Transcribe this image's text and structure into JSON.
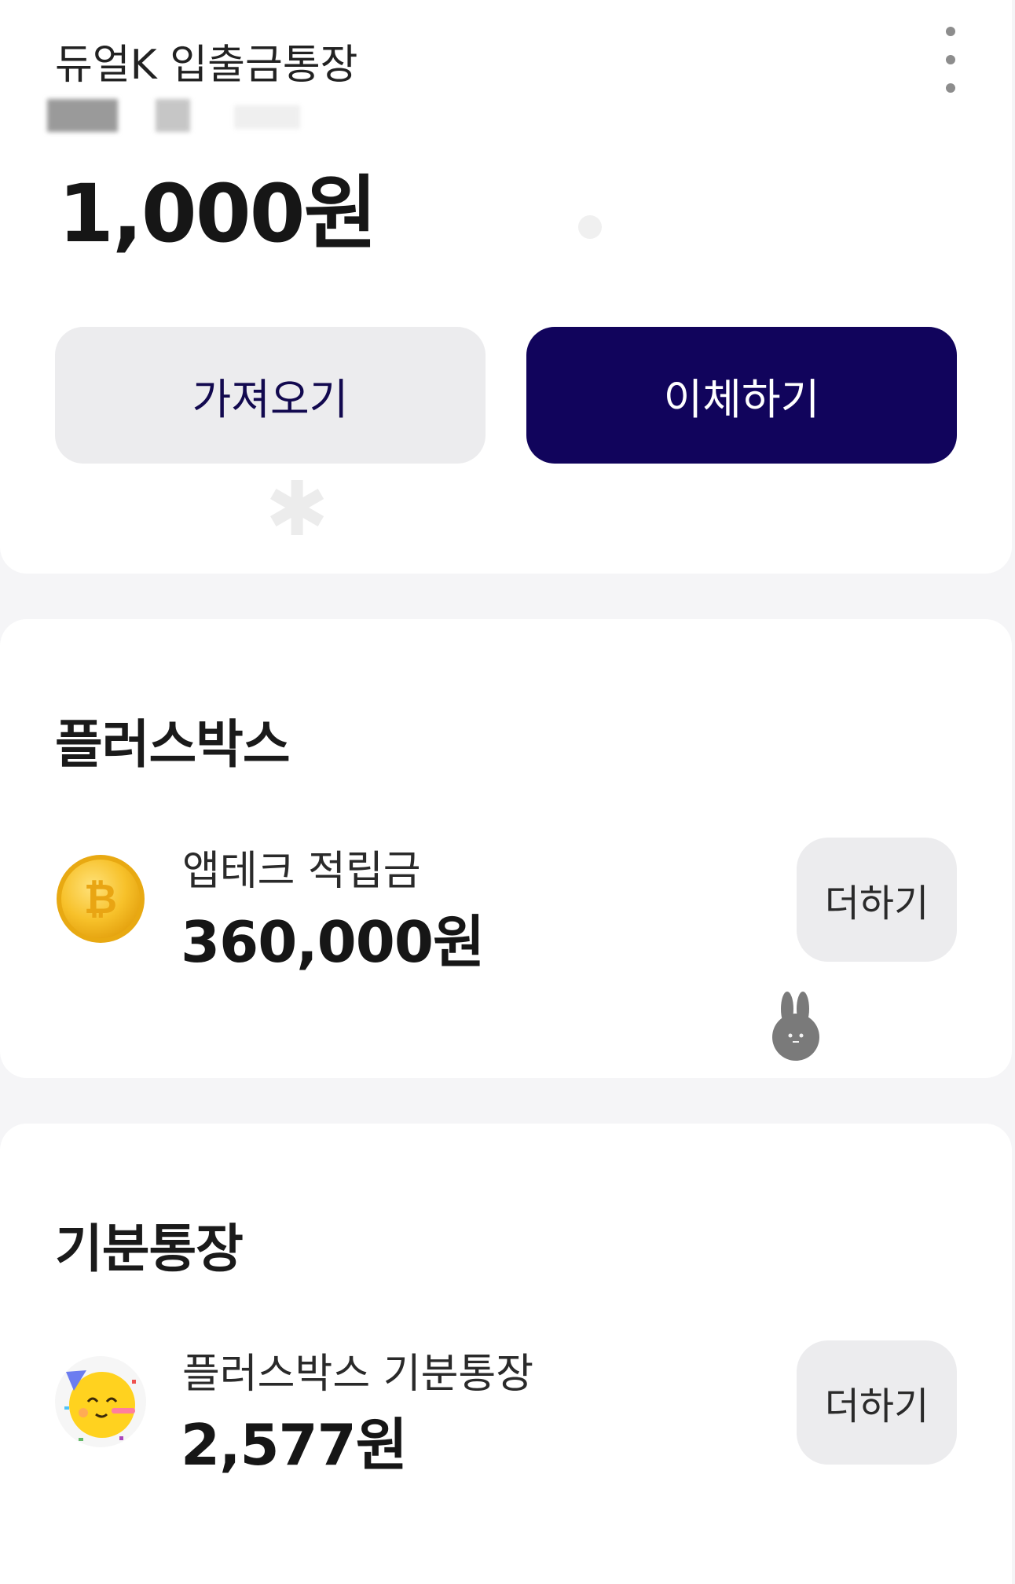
{
  "account": {
    "name": "듀얼K 입출금통장",
    "balance": "1,000원",
    "buttons": {
      "get_label": "가져오기",
      "transfer_label": "이체하기"
    }
  },
  "plusbox": {
    "title": "플러스박스",
    "item": {
      "icon": "bitcoin-coin-icon",
      "label": "앱테크 적립금",
      "amount": "360,000원",
      "add_label": "더하기"
    }
  },
  "mood": {
    "title": "기분통장",
    "item": {
      "icon": "party-emoji-icon",
      "label": "플러스박스 기분통장",
      "amount": "2,577원",
      "add_label": "더하기"
    }
  },
  "colors": {
    "primary": "#11045c",
    "secondary_button": "#ececee",
    "background": "#f5f5f7"
  }
}
